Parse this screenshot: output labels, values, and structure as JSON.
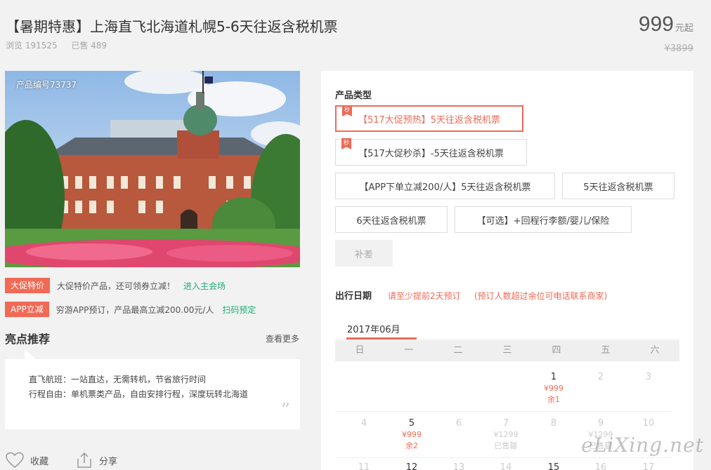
{
  "header": {
    "title": "【暑期特惠】上海直飞北海道札幌5-6天往返含税机票",
    "views": "浏览 191525",
    "sold": "已售 489",
    "price": "999",
    "price_unit": "元起",
    "old_price": "¥3899"
  },
  "photo": {
    "product_code": "产品编号73737"
  },
  "promos": [
    {
      "tag": "大促特价",
      "text": "大促特价产品，还可领券立减！",
      "link": "进入主会场"
    },
    {
      "tag": "APP立减",
      "text": "穷游APP预订，产品最高立减200.00元/人",
      "link": "扫码预定"
    }
  ],
  "highlights": {
    "title": "亮点推荐",
    "more": "查看更多",
    "lines": [
      "直飞航班：一站直达，无需转机，节省旅行时间",
      "行程自由：单机票类产品，自由安排行程，深度玩转北海道"
    ],
    "quote": "”"
  },
  "actions": {
    "favorite": "收藏",
    "share": "分享"
  },
  "product_type": {
    "label": "产品类型",
    "badge": "秒",
    "options": [
      "【517大促预热】5天往返含税机票",
      "【517大促秒杀】-5天往返含税机票",
      "【APP下单立减200/人】5天往返含税机票",
      "5天往返含税机票",
      "6天往返含税机票",
      "【可选】+回程行李额/婴儿/保险",
      "补差"
    ]
  },
  "date": {
    "label": "出行日期",
    "note1": "请至少提前2天预订",
    "note2": "(预订人数超过余位可电话联系商家)",
    "month": "2017年06月",
    "weekdays": [
      "日",
      "一",
      "二",
      "三",
      "四",
      "五",
      "六"
    ],
    "days": [
      {
        "d": "1",
        "p": "¥999",
        "s": "余1"
      },
      {
        "d": "2",
        "p": "",
        "s": ""
      },
      {
        "d": "3",
        "p": "",
        "s": ""
      },
      {
        "d": "4",
        "p": "",
        "s": ""
      },
      {
        "d": "5",
        "p": "¥999",
        "s": "余2"
      },
      {
        "d": "6",
        "p": "",
        "s": ""
      },
      {
        "d": "7",
        "p": "¥1299",
        "s": "已售罄"
      },
      {
        "d": "8",
        "p": "",
        "s": ""
      },
      {
        "d": "9",
        "p": "¥1299",
        "s": "已售罄"
      },
      {
        "d": "10",
        "p": "",
        "s": ""
      },
      {
        "d": "11",
        "p": "",
        "s": ""
      },
      {
        "d": "12",
        "p": "",
        "s": ""
      },
      {
        "d": "13",
        "p": "",
        "s": ""
      },
      {
        "d": "14",
        "p": "",
        "s": ""
      },
      {
        "d": "15",
        "p": "",
        "s": ""
      },
      {
        "d": "16",
        "p": "",
        "s": ""
      },
      {
        "d": "17",
        "p": "",
        "s": ""
      }
    ]
  },
  "watermark": "eLiXing.net",
  "colors": {
    "accent": "#f06a55",
    "link_green": "#1cae77"
  }
}
